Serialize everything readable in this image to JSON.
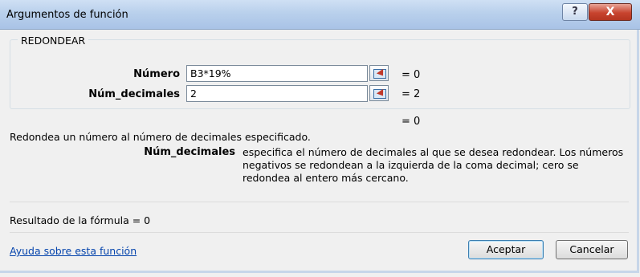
{
  "window": {
    "title": "Argumentos de función",
    "help_glyph": "?",
    "close_glyph": "X"
  },
  "function_group": {
    "name": "REDONDEAR",
    "args": [
      {
        "label": "Número",
        "value": "B3*19%",
        "result": "=  0"
      },
      {
        "label": "Núm_decimales",
        "value": "2",
        "result": "=  2"
      }
    ],
    "overall_result": "=  0"
  },
  "function_description": "Redondea un número al número de decimales especificado.",
  "argument_help": {
    "label": "Núm_decimales",
    "text": "especifica el número de decimales al que se desea redondear. Los números negativos se redondean a la izquierda de la coma decimal; cero se redondea al entero más cercano."
  },
  "formula_result": "Resultado de la fórmula =  0",
  "help_link": "Ayuda sobre esta función",
  "buttons": {
    "ok": "Aceptar",
    "cancel": "Cancelar"
  },
  "colors": {
    "titlebar": "#b9d0ec",
    "link": "#0645ad",
    "close": "#c8442f"
  }
}
